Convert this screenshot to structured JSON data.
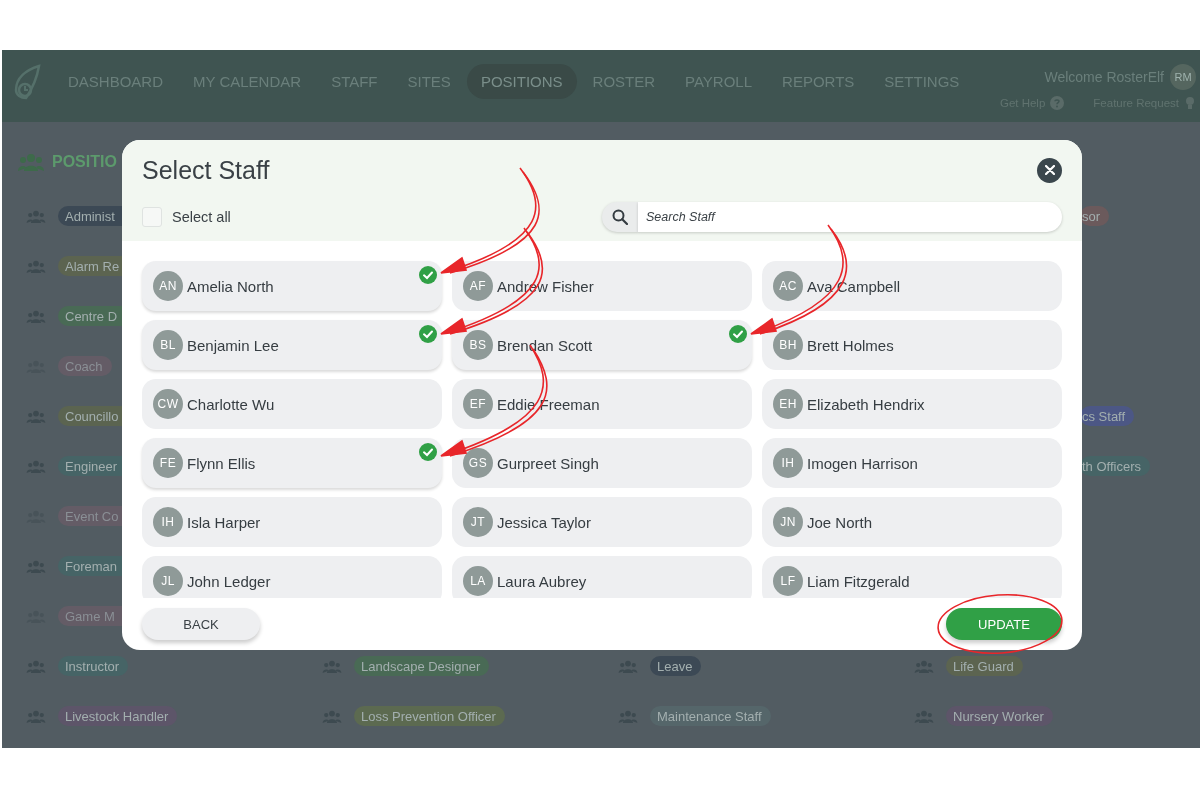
{
  "nav": {
    "items": [
      {
        "label": "DASHBOARD",
        "selected": false
      },
      {
        "label": "MY CALENDAR",
        "selected": false
      },
      {
        "label": "STAFF",
        "selected": false
      },
      {
        "label": "SITES",
        "selected": false
      },
      {
        "label": "POSITIONS",
        "selected": true
      },
      {
        "label": "ROSTER",
        "selected": false
      },
      {
        "label": "PAYROLL",
        "selected": false
      },
      {
        "label": "REPORTS",
        "selected": false
      },
      {
        "label": "SETTINGS",
        "selected": false
      }
    ],
    "welcome": "Welcome RosterElf",
    "avatar": "RM",
    "help": "Get Help",
    "feature_request": "Feature Request"
  },
  "page_title": "POSITIO",
  "positions": [
    {
      "cells": [
        {
          "label": "Administ",
          "color": "#3c4955",
          "disabled": false,
          "kind": "cut_right"
        },
        null,
        null,
        {
          "label": "sor",
          "color": "#6b5a5c",
          "disabled": false,
          "kind": "cut_left"
        }
      ]
    },
    {
      "cells": [
        {
          "label": "Alarm Re",
          "color": "#5c6450",
          "disabled": false,
          "kind": "cut_right"
        },
        null,
        null,
        null
      ]
    },
    {
      "cells": [
        {
          "label": "Centre D",
          "color": "#496a55",
          "disabled": false,
          "kind": "cut_right"
        },
        null,
        null,
        null
      ]
    },
    {
      "cells": [
        {
          "label": "Coach",
          "color": "#645c66",
          "disabled": true,
          "kind": "full"
        },
        null,
        null,
        null
      ]
    },
    {
      "cells": [
        {
          "label": "Councillo",
          "color": "#5b6450",
          "disabled": false,
          "kind": "cut_right"
        },
        null,
        null,
        {
          "label": "cs Staff",
          "color": "#4c5785",
          "disabled": false,
          "kind": "cut_left"
        }
      ]
    },
    {
      "cells": [
        {
          "label": "Engineer",
          "color": "#466466",
          "disabled": false,
          "kind": "cut_right"
        },
        null,
        null,
        {
          "label": "th Officers",
          "color": "#466466",
          "disabled": false,
          "kind": "cut_left"
        }
      ]
    },
    {
      "cells": [
        {
          "label": "Event Co",
          "color": "#645c66",
          "disabled": true,
          "kind": "cut_right"
        },
        null,
        null,
        null
      ]
    },
    {
      "cells": [
        {
          "label": "Foreman",
          "color": "#466466",
          "disabled": false,
          "kind": "cut_right"
        },
        null,
        null,
        null
      ]
    },
    {
      "cells": [
        {
          "label": "Game M",
          "color": "#645c66",
          "disabled": true,
          "kind": "cut_right"
        },
        null,
        null,
        null
      ]
    },
    {
      "cells": [
        {
          "label": "Instructor",
          "color": "#466466",
          "disabled": false,
          "kind": "full"
        },
        {
          "label": "Landscape Designer",
          "color": "#496a55",
          "disabled": false,
          "kind": "full"
        },
        {
          "label": "Leave",
          "color": "#3c4955",
          "disabled": false,
          "kind": "full"
        },
        {
          "label": "Life Guard",
          "color": "#5c6450",
          "disabled": false,
          "kind": "full"
        }
      ]
    },
    {
      "cells": [
        {
          "label": "Livestock Handler",
          "color": "#5d5569",
          "disabled": false,
          "kind": "full"
        },
        {
          "label": "Loss Prevention Officer",
          "color": "#5c6a50",
          "disabled": false,
          "kind": "full"
        },
        {
          "label": "Maintenance Staff",
          "color": "#55666a",
          "disabled": false,
          "kind": "full"
        },
        {
          "label": "Nursery Worker",
          "color": "#5d5569",
          "disabled": false,
          "kind": "full"
        }
      ]
    }
  ],
  "modal": {
    "title": "Select Staff",
    "select_all": {
      "label": "Select all",
      "checked": false
    },
    "search": {
      "placeholder": "Search Staff"
    },
    "staff": [
      {
        "initials": "AN",
        "name": "Amelia North",
        "checked": true
      },
      {
        "initials": "AF",
        "name": "Andrew Fisher",
        "checked": false
      },
      {
        "initials": "AC",
        "name": "Ava Campbell",
        "checked": false
      },
      {
        "initials": "BL",
        "name": "Benjamin Lee",
        "checked": true
      },
      {
        "initials": "BS",
        "name": "Brendan Scott",
        "checked": true
      },
      {
        "initials": "BH",
        "name": "Brett Holmes",
        "checked": false
      },
      {
        "initials": "CW",
        "name": "Charlotte Wu",
        "checked": false
      },
      {
        "initials": "EF",
        "name": "Eddie Freeman",
        "checked": false
      },
      {
        "initials": "EH",
        "name": "Elizabeth Hendrix",
        "checked": false
      },
      {
        "initials": "FE",
        "name": "Flynn Ellis",
        "checked": true
      },
      {
        "initials": "GS",
        "name": "Gurpreet Singh",
        "checked": false
      },
      {
        "initials": "IH",
        "name": "Imogen Harrison",
        "checked": false
      },
      {
        "initials": "IH",
        "name": "Isla Harper",
        "checked": false
      },
      {
        "initials": "JT",
        "name": "Jessica Taylor",
        "checked": false
      },
      {
        "initials": "JN",
        "name": "Joe North",
        "checked": false
      },
      {
        "initials": "JL",
        "name": "John Ledger",
        "checked": false
      },
      {
        "initials": "LA",
        "name": "Laura Aubrey",
        "checked": false
      },
      {
        "initials": "LF",
        "name": "Liam Fitzgerald",
        "checked": false
      }
    ],
    "back": "BACK",
    "update": "UPDATE"
  }
}
